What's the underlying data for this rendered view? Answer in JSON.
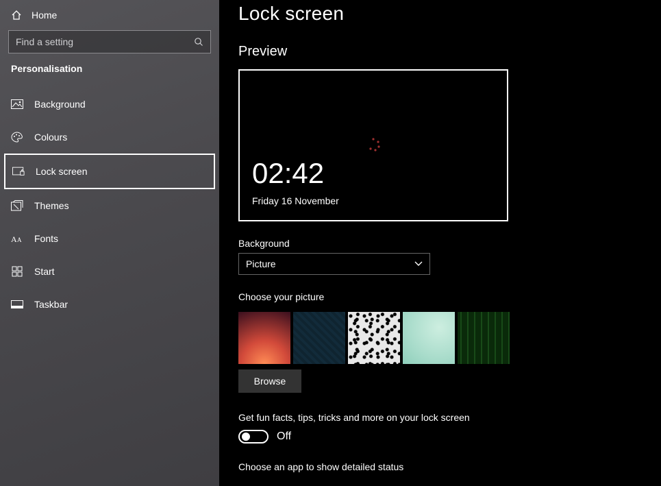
{
  "sidebar": {
    "home": "Home",
    "search_placeholder": "Find a setting",
    "category": "Personalisation",
    "items": [
      {
        "label": "Background"
      },
      {
        "label": "Colours"
      },
      {
        "label": "Lock screen"
      },
      {
        "label": "Themes"
      },
      {
        "label": "Fonts"
      },
      {
        "label": "Start"
      },
      {
        "label": "Taskbar"
      }
    ]
  },
  "main": {
    "title": "Lock screen",
    "preview_label": "Preview",
    "preview_time": "02:42",
    "preview_date": "Friday 16 November",
    "background_label": "Background",
    "background_value": "Picture",
    "choose_picture_label": "Choose your picture",
    "browse": "Browse",
    "fun_facts_label": "Get fun facts, tips, tricks and more on your lock screen",
    "toggle_state": "Off",
    "app_label": "Choose an app to show detailed status"
  }
}
